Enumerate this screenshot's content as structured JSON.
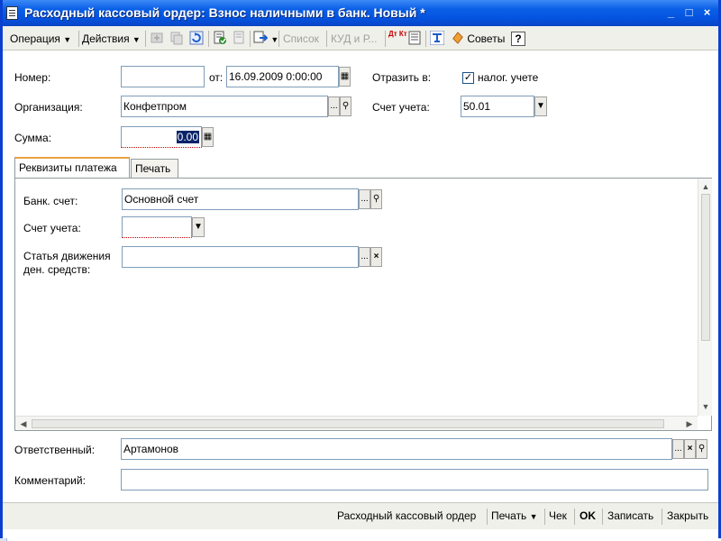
{
  "window": {
    "title": "Расходный кассовый ордер: Взнос наличными в банк. Новый *",
    "min_glyph": "_",
    "max_glyph": "□",
    "close_glyph": "×"
  },
  "toolbar": {
    "operation_label": "Операция",
    "actions_label": "Действия",
    "list_label": "Список",
    "kud_label": "КУД и Р...",
    "dtkt_label": "Дт Кт",
    "tips_label": "Советы",
    "help_glyph": "?"
  },
  "header": {
    "number_label": "Номер:",
    "number_value": "",
    "date_label": "от:",
    "date_value": "16.09.2009  0:00:00",
    "reflect_label": "Отразить в:",
    "tax_label": "налог. учете",
    "tax_checked": true,
    "org_label": "Организация:",
    "org_value": "Конфетпром",
    "account_label": "Счет учета:",
    "account_value": "50.01",
    "sum_label": "Сумма:",
    "sum_value": "0.00"
  },
  "tabs": [
    {
      "label": "Реквизиты платежа",
      "active": true
    },
    {
      "label": "Печать",
      "active": false
    }
  ],
  "payment": {
    "bank_label": "Банк. счет:",
    "bank_value": "Основной счет",
    "account_label": "Счет учета:",
    "account_value": "",
    "cashflow_label_line1": "Статья движения",
    "cashflow_label_line2": "ден. средств:",
    "cashflow_value": ""
  },
  "footer": {
    "responsible_label": "Ответственный:",
    "responsible_value": "Артамонов",
    "comment_label": "Комментарий:",
    "comment_value": ""
  },
  "bottombar": {
    "doc_label": "Расходный кассовый ордер",
    "print_label": "Печать",
    "check_label": "Чек",
    "ok_label": "OK",
    "save_label": "Записать",
    "close_label": "Закрыть"
  },
  "colors": {
    "titlebar": "#0553e0",
    "selection": "#0a246a",
    "required_underline": "#c00000"
  }
}
